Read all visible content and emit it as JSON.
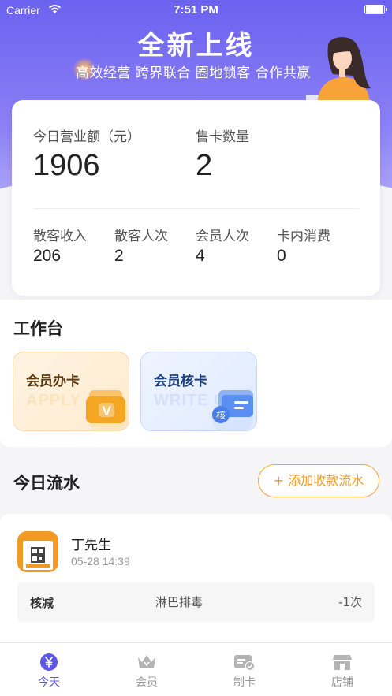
{
  "status_bar": {
    "carrier": "Carrier",
    "time": "7:51 PM"
  },
  "hero": {
    "title": "全新上线",
    "subtitle": "高效经营 跨界联合 圈地锁客 合作共赢"
  },
  "stats": {
    "revenue_label": "今日营业额（元）",
    "revenue_value": "1906",
    "cards_sold_label": "售卡数量",
    "cards_sold_value": "2",
    "items": [
      {
        "label": "散客收入",
        "value": "206"
      },
      {
        "label": "散客人次",
        "value": "2"
      },
      {
        "label": "会员人次",
        "value": "4"
      },
      {
        "label": "卡内消费",
        "value": "0"
      }
    ]
  },
  "workbench": {
    "title": "工作台",
    "tiles": [
      {
        "label": "会员办卡",
        "watermark": "APPLY C",
        "badge": "V",
        "color": "#f39a24"
      },
      {
        "label": "会员核卡",
        "watermark": "WRITE O",
        "badge": "核",
        "color": "#3f7be8"
      }
    ]
  },
  "today_flow": {
    "title": "今日流水",
    "add_button": "+ 添加收款流水",
    "records": [
      {
        "name": "丁先生",
        "time": "05-28 14:39",
        "type": "核减",
        "item": "淋巴排毒",
        "quantity": "-1次"
      }
    ]
  },
  "tabbar": {
    "active_color": "#5b57e8",
    "tabs": [
      {
        "label": "今天",
        "icon": "yen-icon",
        "active": true
      },
      {
        "label": "会员",
        "icon": "crown-icon",
        "active": false
      },
      {
        "label": "制卡",
        "icon": "card-check-icon",
        "active": false
      },
      {
        "label": "店铺",
        "icon": "store-icon",
        "active": false
      }
    ]
  }
}
